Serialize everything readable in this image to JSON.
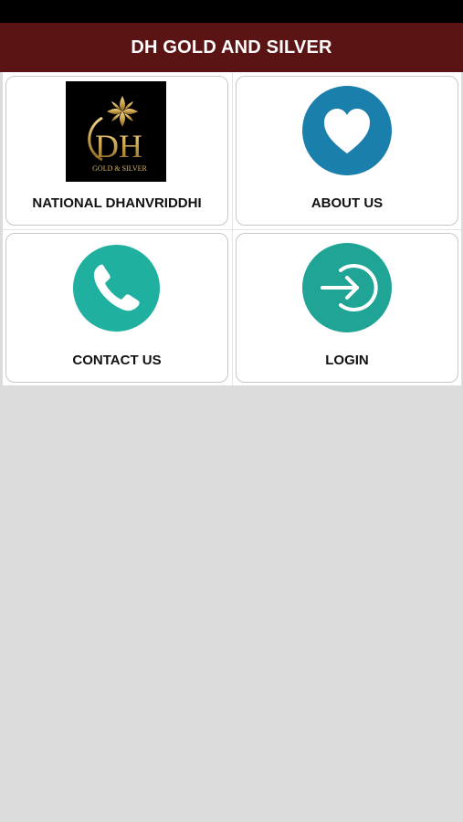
{
  "header": {
    "title": "DH GOLD AND SILVER"
  },
  "logo": {
    "monogram": "DH",
    "tagline": "GOLD & SILVER"
  },
  "tiles": [
    {
      "label": "NATIONAL DHANVRIDDHI",
      "icon": "dh-logo-icon"
    },
    {
      "label": "ABOUT US",
      "icon": "heart-icon"
    },
    {
      "label": "CONTACT US",
      "icon": "phone-icon"
    },
    {
      "label": "LOGIN",
      "icon": "login-arrow-icon"
    }
  ],
  "colors": {
    "header_bg": "#5b1414",
    "about_icon_bg": "#1b7fab",
    "contact_icon_bg": "#1fb0a0",
    "login_icon_bg": "#1fa495",
    "logo_gold": "#c9a24a",
    "background": "#dcdcdc"
  }
}
